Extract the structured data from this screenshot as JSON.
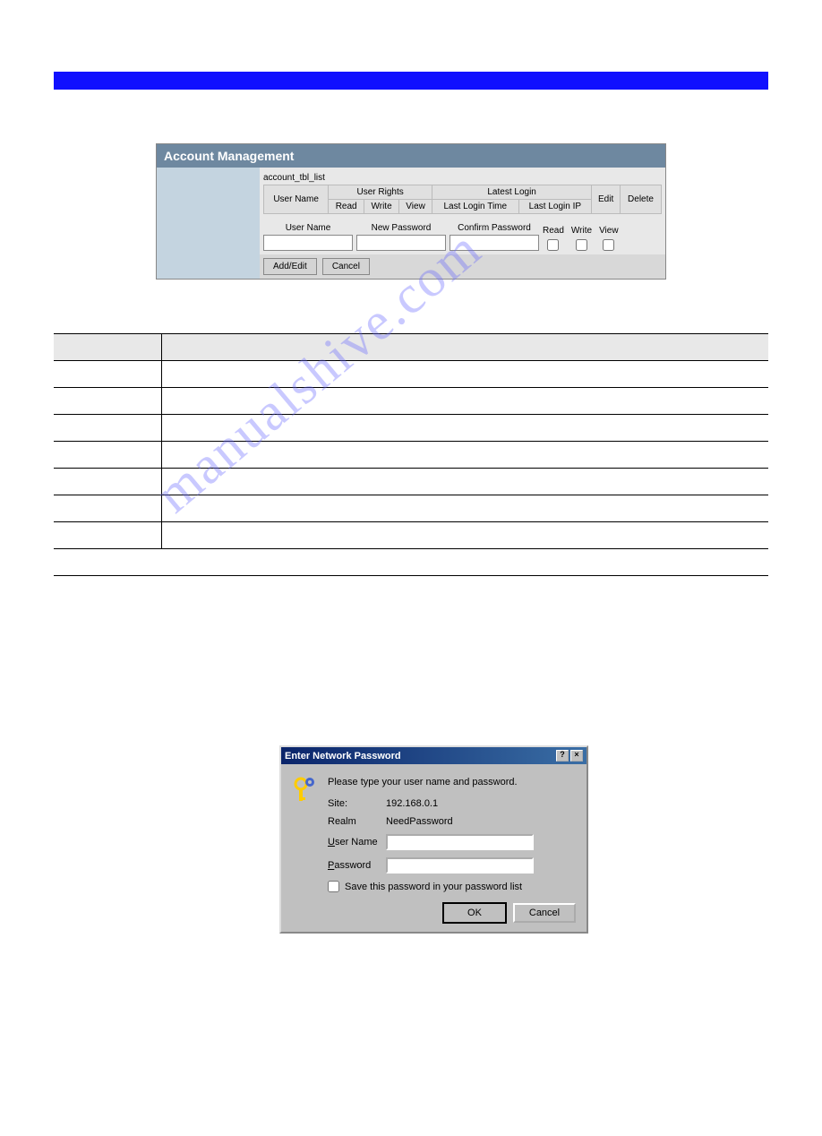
{
  "accountPanel": {
    "title": "Account Management",
    "listLabel": "account_tbl_list",
    "headers": {
      "userName": "User Name",
      "userRights": "User Rights",
      "latestLogin": "Latest Login",
      "edit": "Edit",
      "delete": "Delete",
      "read": "Read",
      "write": "Write",
      "view": "View",
      "lastLoginTime": "Last Login Time",
      "lastLoginIP": "Last Login IP"
    },
    "form": {
      "userNameLabel": "User Name",
      "newPasswordLabel": "New Password",
      "confirmPasswordLabel": "Confirm Password",
      "readLabel": "Read",
      "writeLabel": "Write",
      "viewLabel": "View",
      "userNameValue": "",
      "newPasswordValue": "",
      "confirmPasswordValue": ""
    },
    "buttons": {
      "addEdit": "Add/Edit",
      "cancel": "Cancel"
    }
  },
  "watermark": "manualshive.com",
  "dialog": {
    "title": "Enter Network Password",
    "message": "Please type your user name and password.",
    "siteLabel": "Site:",
    "siteValue": "192.168.0.1",
    "realmLabel": "Realm",
    "realmValue": "NeedPassword",
    "userNameLabel": "User Name",
    "userNameUnderline": "U",
    "passwordLabel": "Password",
    "passwordUnderline": "P",
    "saveLabel": "Save this password in your password list",
    "saveUnderline": "S",
    "okButton": "OK",
    "cancelButton": "Cancel",
    "userNameValue": "",
    "passwordValue": ""
  }
}
